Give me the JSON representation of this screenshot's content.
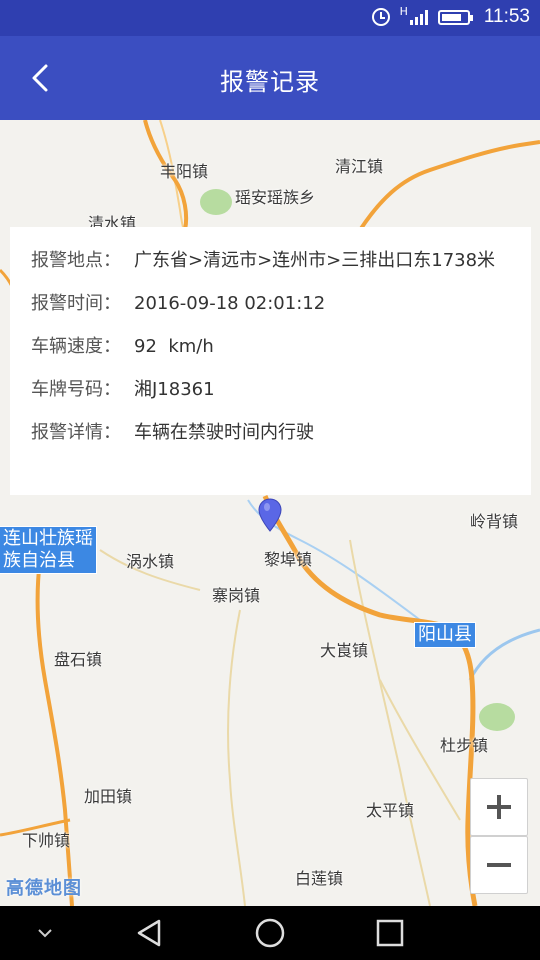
{
  "status_bar": {
    "time": "11:53",
    "network_label": "H",
    "battery_level": 0.8
  },
  "header": {
    "title": "报警记录",
    "back_icon": "back-arrow-icon"
  },
  "alarm": {
    "location_label": "报警地点：",
    "location_value": "广东省>清远市>连州市>三排出口东1738米",
    "time_label": "报警时间：",
    "time_value": "2016-09-18 02:01:12",
    "speed_label": "车辆速度：",
    "speed_value": "92  km/h",
    "plate_label": "车牌号码：",
    "plate_value": "湘J18361",
    "detail_label": "报警详情：",
    "detail_value": "车辆在禁驶时间内行驶"
  },
  "map": {
    "places": {
      "fengyang": "丰阳镇",
      "qingjiang": "清江镇",
      "yaoan": "瑶安瑶族乡",
      "qingshui": "清水镇",
      "wolin": "涡水镇",
      "libu": "黎埠镇",
      "zhaigang": "寨岗镇",
      "dajian": "大崀镇",
      "panshi": "盘石镇",
      "jiatian": "加田镇",
      "xiashuai": "下帅镇",
      "taiping": "太平镇",
      "bailian": "白莲镇",
      "dubu": "杜步镇",
      "lingbei": "岭背镇"
    },
    "counties": {
      "lianshan_line1": "连山壮族瑶",
      "lianshan_line2": "族自治县",
      "yangshan": "阳山县"
    },
    "logo": "高德地图",
    "zoom_in_label": "+",
    "zoom_out_label": "−"
  },
  "colors": {
    "status_bar": "#2f3fb0",
    "app_bar": "#3b4ec1",
    "road": "#f2a33a",
    "county_badge": "#3c88e3",
    "marker": "#5a67e6"
  }
}
